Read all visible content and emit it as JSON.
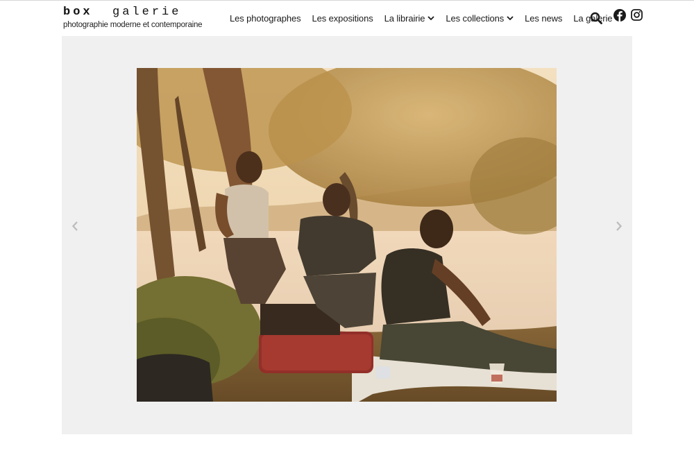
{
  "logo": {
    "title_left": "box",
    "title_right": "galerie",
    "subtitle": "photographie moderne et contemporaine"
  },
  "nav": {
    "items": [
      {
        "label": "Les photographes",
        "has_dropdown": false
      },
      {
        "label": "Les expositions",
        "has_dropdown": false
      },
      {
        "label": "La librairie",
        "has_dropdown": true
      },
      {
        "label": "Les collections",
        "has_dropdown": true
      },
      {
        "label": "Les news",
        "has_dropdown": false
      },
      {
        "label": "La galerie",
        "has_dropdown": false
      }
    ]
  },
  "header_icons": {
    "search": "search-icon",
    "facebook": "facebook-icon",
    "instagram": "instagram-icon"
  },
  "carousel": {
    "prev": "chevron-left-icon",
    "next": "chevron-right-icon",
    "photo_subject": "three young people sitting by a lake under trees at sunset"
  },
  "colors": {
    "carousel_bg": "#f0f0f0",
    "text": "#1a1a1a",
    "arrow": "#bdbdbd"
  }
}
